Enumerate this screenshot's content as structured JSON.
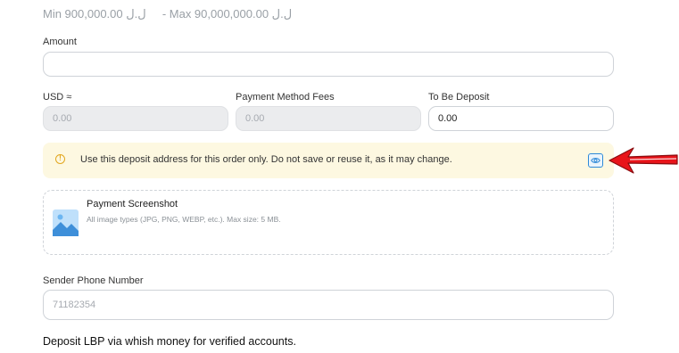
{
  "limits": {
    "min_text": "Min 900,000.00 ل.ل",
    "max_text": "- Max 90,000,000.00 ل.ل"
  },
  "amount": {
    "label": "Amount",
    "value": ""
  },
  "usd": {
    "label": "USD ≈",
    "value": "0.00"
  },
  "fees": {
    "label": "Payment Method Fees",
    "value": "0.00"
  },
  "to_be_deposit": {
    "label": "To Be Deposit",
    "value": "0.00"
  },
  "notice": {
    "icon": "info-circle-icon",
    "text": "Use this deposit address for this order only. Do not save or reuse it, as it may change.",
    "action_icon": "eye-icon",
    "accent_color": "#e2a720",
    "background_color": "#fdf8e1"
  },
  "upload": {
    "title": "Payment Screenshot",
    "hint": "All image types (JPG, PNG, WEBP, etc.). Max size: 5 MB.",
    "icon": "image-icon"
  },
  "sender_phone": {
    "label": "Sender Phone Number",
    "placeholder": "71182354"
  },
  "footer": {
    "text": "Deposit LBP via whish money for verified accounts."
  },
  "annotation": {
    "arrow_color": "#e8141a",
    "icon": "red-arrow-icon"
  }
}
